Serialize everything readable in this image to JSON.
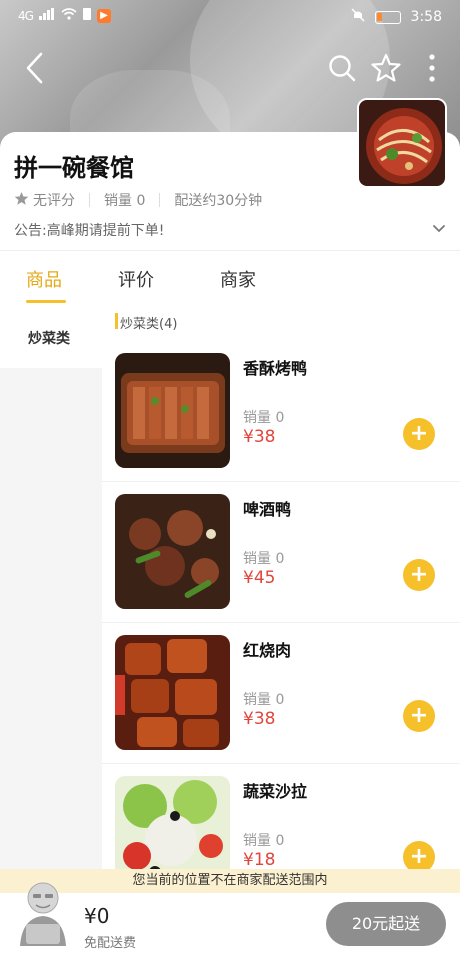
{
  "status_bar": {
    "network": "4G",
    "time": "3:58"
  },
  "shop": {
    "name": "拼一碗餐馆",
    "rating": "无评分",
    "sales": "销量 0",
    "delivery_time": "配送约30分钟",
    "notice": "公告:高峰期请提前下单!"
  },
  "tabs": [
    {
      "label": "商品"
    },
    {
      "label": "评价"
    },
    {
      "label": "商家"
    }
  ],
  "categories": [
    {
      "label": "炒菜类"
    }
  ],
  "category_heading": "炒菜类(4)",
  "products": [
    {
      "name": "香酥烤鸭",
      "sales": "销量 0",
      "price": "¥38",
      "add": "+"
    },
    {
      "name": "啤酒鸭",
      "sales": "销量 0",
      "price": "¥45",
      "add": "+"
    },
    {
      "name": "红烧肉",
      "sales": "销量 0",
      "price": "¥38",
      "add": "+"
    },
    {
      "name": "蔬菜沙拉",
      "sales": "销量 0",
      "price": "¥18",
      "add": "+"
    }
  ],
  "cart": {
    "range_tip": "您当前的位置不在商家配送范围内",
    "total": "¥0",
    "delivery_fee": "免配送费",
    "checkout_label": "20元起送"
  },
  "colors": {
    "accent": "#f5c02a",
    "price": "#e0463d",
    "checkout_disabled": "#8e8e8e"
  }
}
